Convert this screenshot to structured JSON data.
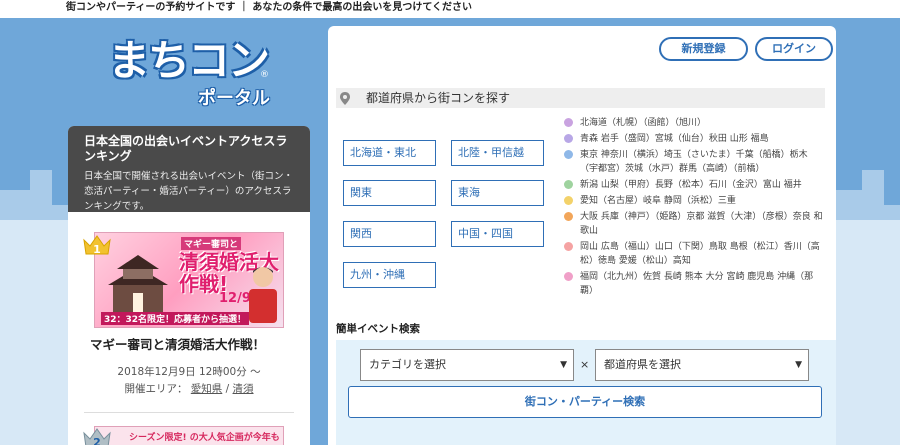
{
  "header": {
    "tagline": "街コンやパーティーの予約サイトです ｜ あなたの条件で最高の出会いを見つけてください"
  },
  "logo": {
    "main": "まちコン",
    "sub": "ポータル",
    "reg": "®"
  },
  "auth": {
    "register": "新規登録",
    "login": "ログイン"
  },
  "ranking": {
    "title": "日本全国の出会いイベントアクセスランキング",
    "description": "日本全国で開催される出会いイベント（街コン・恋活パーティー・婚活パーティー）のアクセスランキングです。",
    "items": [
      {
        "rank": "1",
        "banner_top": "マギー審司と",
        "banner_main": "清須婚活大作戦!",
        "banner_date": "12/9",
        "banner_foot": "32：32名限定！応募者から抽選！",
        "title": "マギー審司と清須婚活大作戦！",
        "date": "2018年12月9日 12時00分 〜",
        "area_label": "開催エリア：",
        "area_pref": "愛知県",
        "area_sep": "/",
        "area_city": "清須"
      },
      {
        "rank": "2",
        "banner_text": "シーズン限定! の大人気企画が今年も開催！"
      }
    ]
  },
  "search": {
    "heading": "都道府県から街コンを探す",
    "regions": [
      "北海道・東北",
      "北陸・甲信越",
      "関東",
      "東海",
      "関西",
      "中国・四国",
      "九州・沖縄"
    ],
    "prefectures": [
      {
        "color": "#c9a3e0",
        "text": "北海道（札幌）（函館）（旭川）"
      },
      {
        "color": "#b8a7e6",
        "text": "青森 岩手（盛岡）宮城（仙台）秋田 山形 福島"
      },
      {
        "color": "#8fb8e8",
        "text": "東京 神奈川（横浜）埼玉（さいたま）千葉（船橋）栃木（宇都宮）茨城（水戸）群馬（高崎）（前橋）"
      },
      {
        "color": "#9fd39f",
        "text": "新潟 山梨（甲府）長野（松本）石川（金沢）富山 福井"
      },
      {
        "color": "#f3d26a",
        "text": "愛知（名古屋）岐阜 静岡（浜松）三重"
      },
      {
        "color": "#f2a65a",
        "text": "大阪 兵庫（神戸）（姫路）京都 滋賀（大津）（彦根）奈良 和歌山"
      },
      {
        "color": "#f5a3a3",
        "text": "岡山 広島（福山）山口（下関）鳥取 島根（松江）香川（高松）徳島 愛媛（松山）高知"
      },
      {
        "color": "#f0a0c8",
        "text": "福岡（北九州）佐賀 長崎 熊本 大分 宮崎 鹿児島 沖縄（那覇）"
      }
    ],
    "simple_label": "簡単イベント検索",
    "category_select": "カテゴリを選択",
    "times": "×",
    "pref_select": "都道府県を選択",
    "submit": "街コン・パーティー検索"
  },
  "colors": {
    "brand": "#2f6fb6",
    "background": "#6fa7d9",
    "accent": "#e01f6e"
  }
}
